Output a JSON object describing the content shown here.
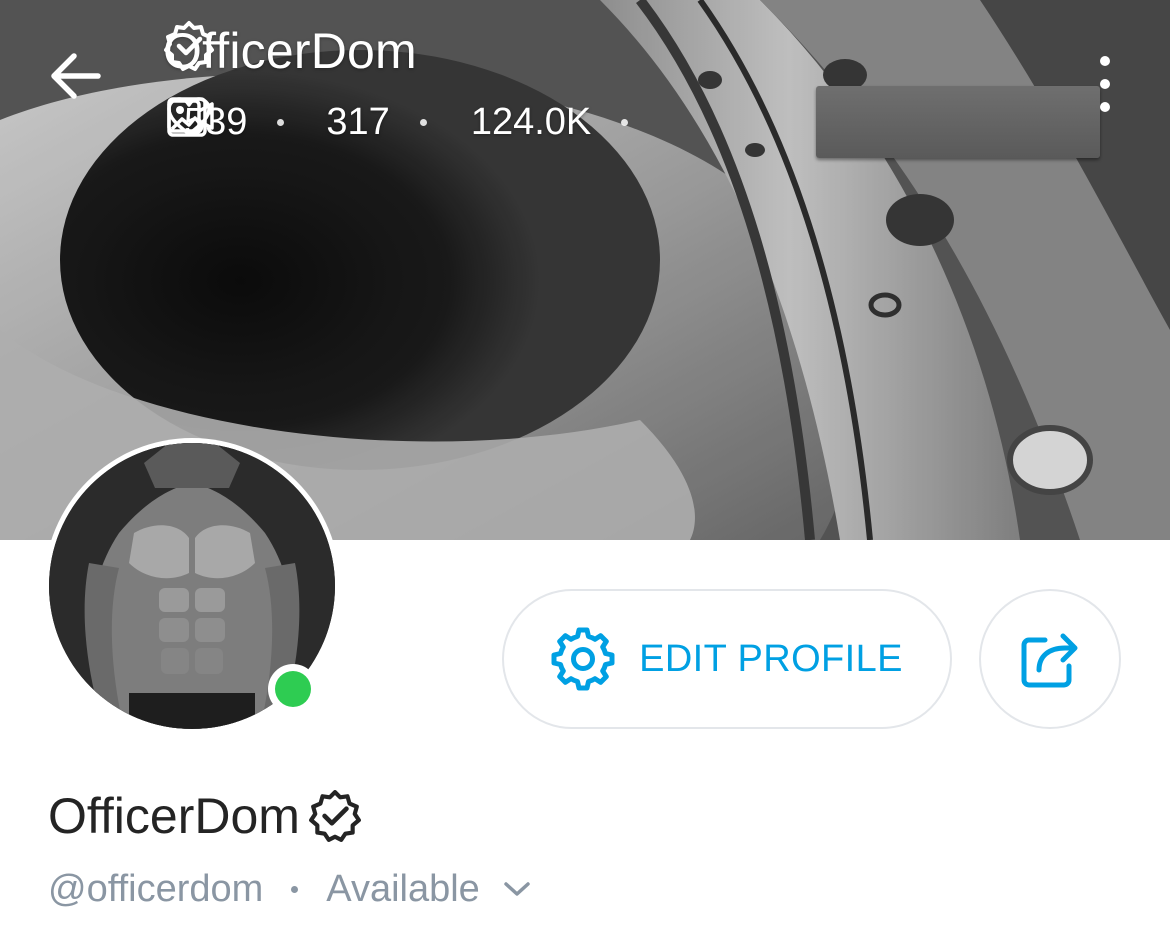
{
  "header": {
    "title": "OfficerDom",
    "stats": {
      "photos": "539",
      "videos": "317",
      "likes": "124.0K"
    }
  },
  "profile": {
    "display_name": "OfficerDom",
    "handle": "@officerdom",
    "status": "Available",
    "online": true
  },
  "actions": {
    "edit_profile_label": "EDIT PROFILE"
  },
  "colors": {
    "accent": "#00a0e3",
    "online": "#2ecc52",
    "muted_text": "#8a96a3",
    "name_text": "#242424"
  },
  "icons": {
    "back": "arrow-left-icon",
    "verified": "verified-badge-icon",
    "photos": "image-icon",
    "videos": "video-icon",
    "likes": "heart-icon",
    "more": "more-vertical-icon",
    "settings": "gear-icon",
    "share": "share-icon",
    "dropdown": "chevron-down-icon"
  }
}
